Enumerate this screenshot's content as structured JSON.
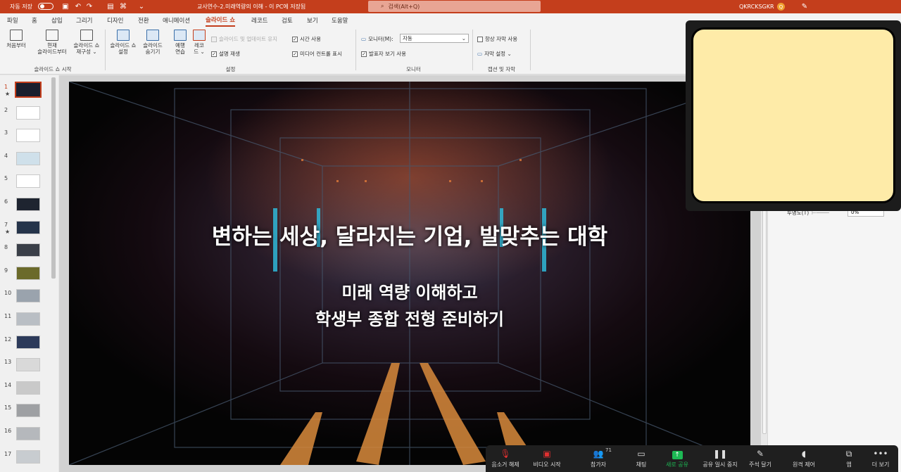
{
  "window": {
    "autosave_label": "자동 저장",
    "autosave_state": "끔",
    "doc_title": "교사연수-2.미래역량의 이해 - 이 PC에 저장됨",
    "search_placeholder": "검색(Alt+Q)",
    "user_name": "QKRCKSGKR"
  },
  "menu_tabs": [
    "파일",
    "홈",
    "삽입",
    "그리기",
    "디자인",
    "전환",
    "애니메이션",
    "슬라이드 쇼",
    "레코드",
    "검토",
    "보기",
    "도움말"
  ],
  "active_tab": "슬라이드 쇼",
  "ribbon": {
    "start_group": {
      "label": "슬라이드 쇼 시작",
      "from_beginning": "처음부터",
      "from_current_1": "현재",
      "from_current_2": "슬라이드부터",
      "custom_1": "슬라이드 쇼",
      "custom_2": "재구성 ⌄"
    },
    "setup_group": {
      "label": "설정",
      "setup_1": "슬라이드 쇼",
      "setup_2": "설정",
      "hide_1": "슬라이드",
      "hide_2": "숨기기",
      "rehearse_1": "예행",
      "rehearse_2": "연습",
      "record_1": "레코",
      "record_2": "드 ⌄",
      "keep_updated": "슬라이드 및 업데이트 유지",
      "narration": "설명 재생",
      "use_timings": "시간 사용",
      "media_controls": "미디어 컨트롤 표시"
    },
    "monitor_group": {
      "label": "모니터",
      "monitor_label": "모니터(M):",
      "monitor_value": "자동",
      "presenter_view": "발표자 보기 사용"
    },
    "caption_group": {
      "label": "캡션 및 자막",
      "always_subtitles": "항상 자막 사용",
      "subtitle_settings": "자막 설정 ⌄"
    }
  },
  "slides": [
    {
      "num": "1",
      "star": "★"
    },
    {
      "num": "2",
      "star": ""
    },
    {
      "num": "3",
      "star": ""
    },
    {
      "num": "4",
      "star": ""
    },
    {
      "num": "5",
      "star": ""
    },
    {
      "num": "6",
      "star": ""
    },
    {
      "num": "7",
      "star": "★"
    },
    {
      "num": "8",
      "star": ""
    },
    {
      "num": "9",
      "star": ""
    },
    {
      "num": "10",
      "star": ""
    },
    {
      "num": "11",
      "star": ""
    },
    {
      "num": "12",
      "star": ""
    },
    {
      "num": "13",
      "star": ""
    },
    {
      "num": "14",
      "star": ""
    },
    {
      "num": "15",
      "star": ""
    },
    {
      "num": "16",
      "star": ""
    },
    {
      "num": "17",
      "star": ""
    }
  ],
  "selected_slide": "1",
  "slide_content": {
    "title": "변하는 세상, 달라지는 기업,  발맞추는 대학",
    "subtitle_1": "미래 역량 이해하고",
    "subtitle_2": "학생부 종합  전형 준비하기"
  },
  "format_pane": {
    "transparency_label": "투명도(T)",
    "transparency_value": "0%"
  },
  "zoom_toolbar": {
    "mute": "음소거 해제",
    "video": "비디오 시작",
    "participants": "참가자",
    "participant_count": "71",
    "chat": "채팅",
    "new_share": "새로 공유",
    "pause_share": "공유 일시 중지",
    "annotate": "주석 달기",
    "remote_control": "원격 제어",
    "apps": "앱",
    "more": "더 보기"
  },
  "colors": {
    "accent": "#c43e1c",
    "sticky_note": "#feeba8",
    "zoom_share_green": "#1db954"
  }
}
